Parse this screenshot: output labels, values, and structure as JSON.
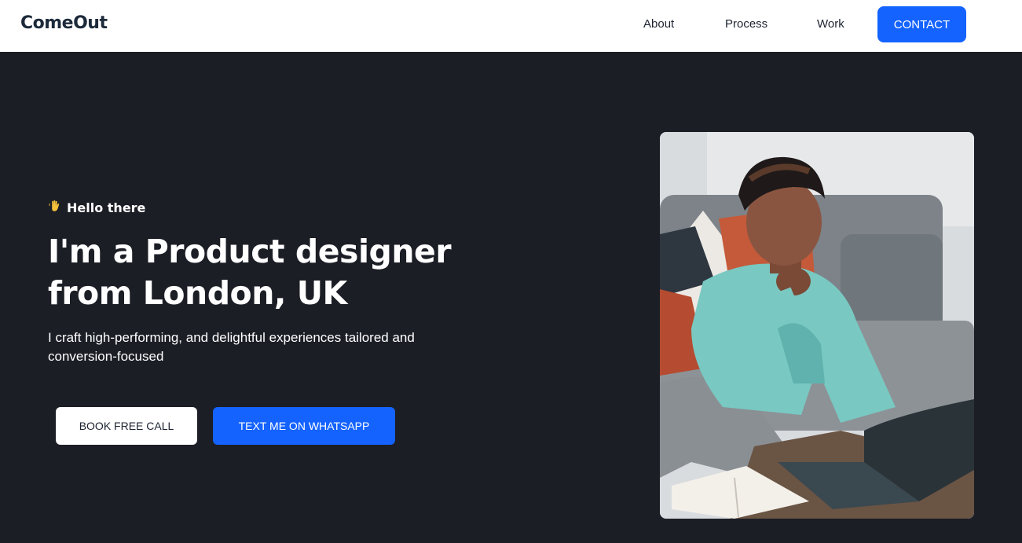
{
  "header": {
    "logo_text": "ComeOut",
    "nav": [
      {
        "label": "About"
      },
      {
        "label": "Process"
      },
      {
        "label": "Work"
      }
    ],
    "cta_label": "CONTACT",
    "accent_color": "#1463ff"
  },
  "hero": {
    "greeting_icon": "waving-hand-icon",
    "greeting": "Hello there",
    "headline_line1": "I'm a Product designer",
    "headline_line2": "from London, UK",
    "subtitle": "I craft high-performing, and delightful experiences tailored and conversion-focused",
    "primary_button": "BOOK FREE CALL",
    "secondary_button": "TEXT ME ON WHATSAPP",
    "background_color": "#1c1e26"
  }
}
